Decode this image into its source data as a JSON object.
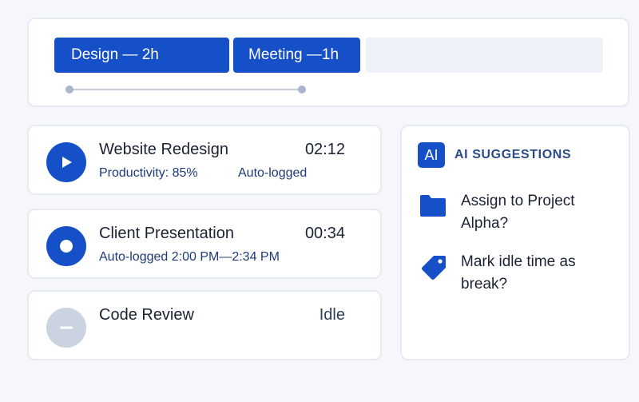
{
  "timeline": {
    "blocks": [
      {
        "label": "Design — 2h"
      },
      {
        "label": "Meeting —1h"
      }
    ]
  },
  "entries": [
    {
      "title": "Website Redesign",
      "time": "02:12",
      "subtitle": "Productivity: 85%",
      "subtitle_right": "Auto-logged",
      "icon": "play-icon"
    },
    {
      "title": "Client Presentation",
      "time": "00:34",
      "subtitle": "Auto-logged 2:00 PM—2:34 PM",
      "icon": "record-icon"
    },
    {
      "title": "Code Review",
      "time": "Idle",
      "icon": "minus-icon"
    }
  ],
  "suggestions": {
    "badge": "AI",
    "title": "AI SUGGESTIONS",
    "items": [
      {
        "text": "Assign to Project Alpha?",
        "icon": "folder-icon"
      },
      {
        "text": "Mark idle time as break?",
        "icon": "tag-icon"
      }
    ]
  },
  "colors": {
    "accent": "#1550c8",
    "idle": "#cbd3e1",
    "background": "#f5f7fb"
  }
}
